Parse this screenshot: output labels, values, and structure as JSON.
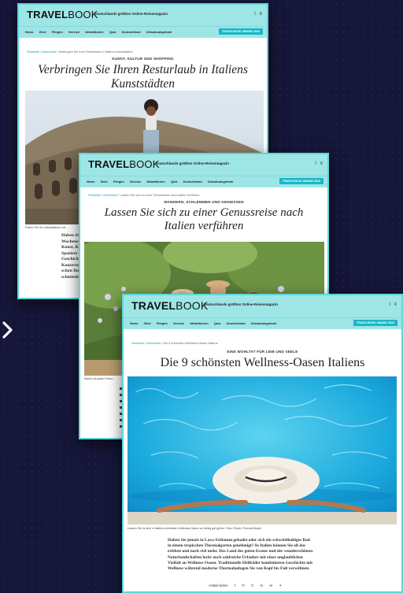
{
  "brand": {
    "logo_bold": "TRAVEL",
    "logo_light": "BOOK",
    "tagline": "Deutschlands größtes Online-Reisemagazin"
  },
  "header_icons": "☾ ≡",
  "nav": {
    "items": [
      "News",
      "Ziele",
      "Fliegen",
      "Service",
      "Attraktionen",
      "Quiz",
      "Deutschland",
      "Urlaubsangebote"
    ],
    "award_button": "TRAVELBOOK AWARD 2023"
  },
  "pages": [
    {
      "breadcrumb_home": "Startseite",
      "breadcrumb_sep1": " / ",
      "breadcrumb_section": "Advertorial",
      "breadcrumb_sep2": " / ",
      "breadcrumb_current": "Verbringen Sie Ihren Resturlaub in Italiens Kunststädten",
      "kicker": "KUNST, KULTUR UND SHOPPING",
      "title": "Verbringen Sie Ihren Resturlaub in Italiens Kunststädten",
      "caption": "Folken Sie Ihr Urlaubsalbum mit ...",
      "body_lines": [
        "Haben Sie",
        "Wochene",
        "Kunst, K",
        "Spaziere",
        "Geschicht",
        "Konzerte",
        "schon Ihr",
        "schmiede"
      ]
    },
    {
      "breadcrumb_home": "Startseite",
      "breadcrumb_sep1": " / ",
      "breadcrumb_section": "Advertorial",
      "breadcrumb_sep2": " / ",
      "breadcrumb_current": "Lassen Sie sich zu einer Genussreise nach Italien verführen",
      "kicker": "WANDERN, SCHLEMMEN UND GENIESSEN",
      "title": "Lassen Sie sich zu einer Genussreise nach Italien verführen",
      "caption": "Macht mit guten Freun..."
    },
    {
      "breadcrumb_home": "Startseite",
      "breadcrumb_sep1": " / ",
      "breadcrumb_section": "Advertorial",
      "breadcrumb_sep2": " / ",
      "breadcrumb_current": "Die 9 schönsten Wellness-Oasen Italiens",
      "kicker": "EINE WOHLTAT FÜR LEIB UND SEELE",
      "title": "Die 9 schönsten Wellness-Oasen Italiens",
      "caption": "Lassen Sie es sich in Italiens schönsten Wellness-Oasen so richtig gut gehen. Foto: iStock / RomoloTavani",
      "body_lines": [
        "Haben Sie jemals in Lava-Schlamm gebadet oder sich ein schwefelhaltiges Bad",
        "in einem tropischen Thermalgarten genehmigt? In Italien können Sie all das",
        "erleben und noch viel mehr. Das Land des guten Essens und der wunderschönen",
        "Naturlandschaften lockt auch zahlreiche Urlauber mit einer unglaublichen",
        "Vielfalt an Wellness-Oasen. Traditionelle Heilbäder kombinieren Geschichte mit",
        "Wellness während moderne Thermalanlagen Sie von Kopf bis Fuß verwöhnen."
      ],
      "share_label": "Artikel teilen"
    }
  ],
  "colors": {
    "background": "#16163a",
    "header": "#9ee6e6",
    "accent": "#18b7c9",
    "frame": "#5fd6da"
  }
}
